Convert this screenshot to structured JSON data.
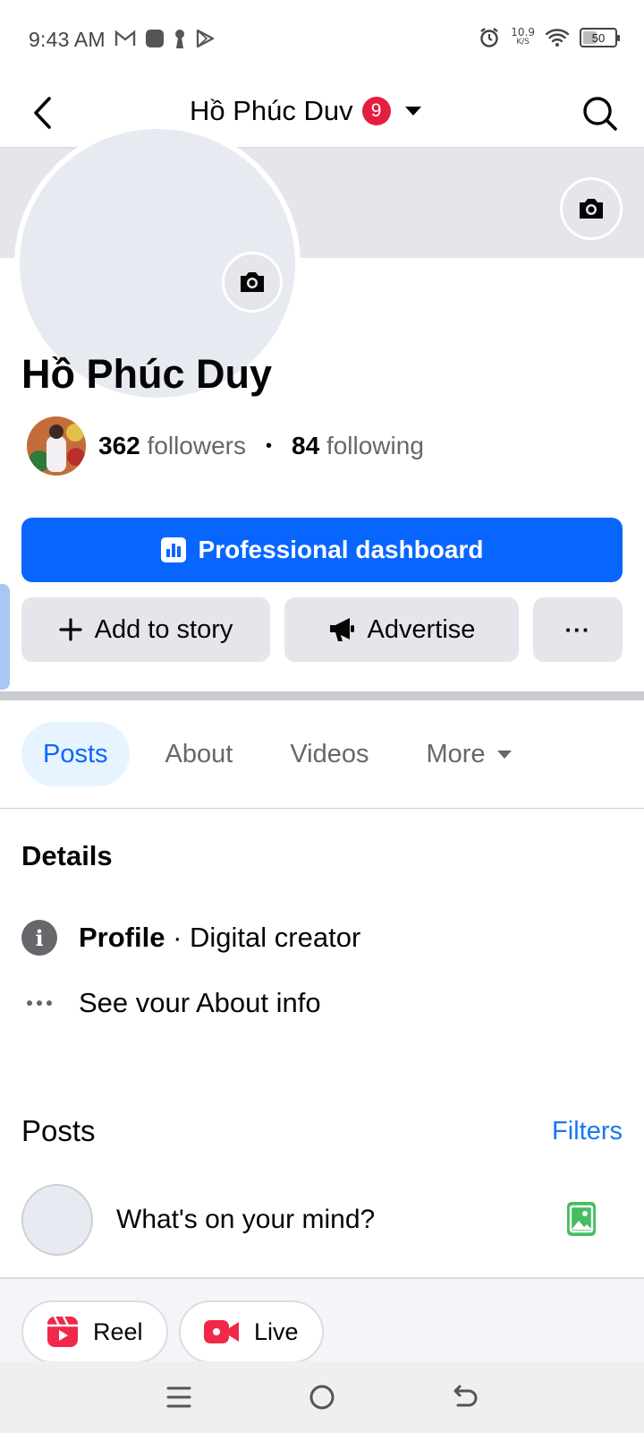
{
  "status_bar": {
    "time": "9:43 AM",
    "net_speed_value": "10.9",
    "net_speed_unit": "K/S",
    "battery": "50",
    "battery_level": 0.5,
    "left_icons": [
      "gmail-icon",
      "app-icon",
      "keyhole-icon",
      "play-store-icon"
    ],
    "right_icons": [
      "alarm-icon",
      "wifi-icon",
      "battery-icon"
    ]
  },
  "header": {
    "title": "Hồ Phúc Duv",
    "badge_count": "9"
  },
  "profile": {
    "name": "Hồ Phúc Duy",
    "followers_count": "362",
    "followers_label": "followers",
    "following_count": "84",
    "following_label": "following",
    "separator": "•"
  },
  "buttons": {
    "professional_dashboard": "Professional dashboard",
    "add_to_story": "Add to story",
    "advertise": "Advertise",
    "more": "···"
  },
  "tabs": [
    {
      "label": "Posts",
      "active": true
    },
    {
      "label": "About",
      "active": false
    },
    {
      "label": "Videos",
      "active": false
    },
    {
      "label": "More",
      "active": false
    }
  ],
  "details": {
    "title": "Details",
    "profile_label": "Profile",
    "profile_value": "· Digital creator",
    "about_link": "See vour About info"
  },
  "posts": {
    "title": "Posts",
    "filters": "Filters",
    "composer_placeholder": "What's on your mind?"
  },
  "chips": {
    "reel": "Reel",
    "live": "Live"
  },
  "colors": {
    "primary": "#0866ff",
    "badge": "#e41e3f",
    "link": "#1877f2",
    "reel": "#f0284a",
    "photo": "#45bd62"
  }
}
